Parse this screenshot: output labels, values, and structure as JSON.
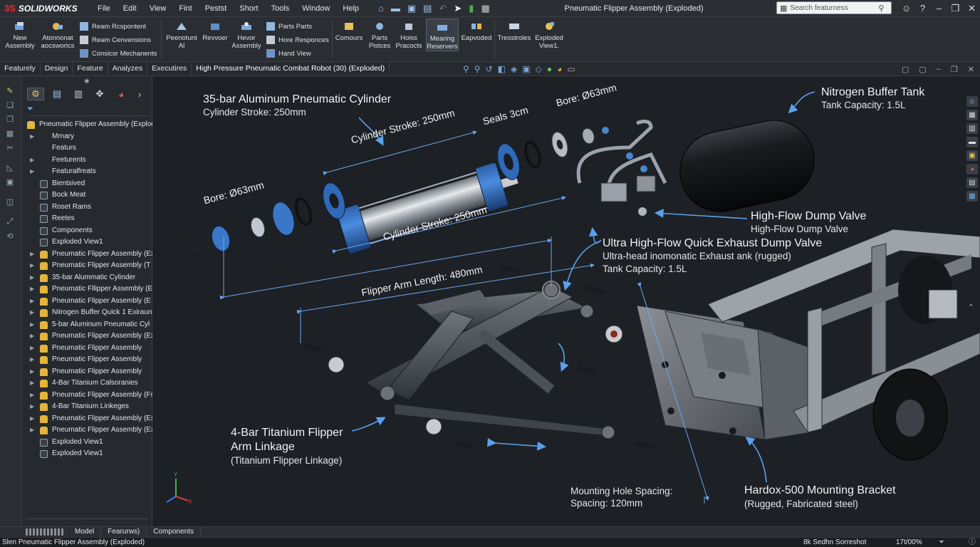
{
  "app": {
    "brand": "SOLIDWORKS",
    "brand_mark": "3S",
    "window_title": "Pneumatic Flipper Assembly (Exploded)"
  },
  "menu": [
    "File",
    "Edit",
    "View",
    "Fint",
    "Pestst",
    "Short",
    "Tools",
    "Window",
    "Help"
  ],
  "search": {
    "placeholder": "Search featurness"
  },
  "ribbon": {
    "new_assembly": "New\nAssembly",
    "atonnonat": "Atonnonat\naocsworics",
    "ream_respont": "Ream Rcspontent",
    "ream_convensions": "Ream Cenvensions",
    "consider_mechanents": "Consicsr Mechanents",
    "peenotunt": "Peenotunt\nAl",
    "revvoer": "Revvoer",
    "hevor_assembly": "Hevor\nAssembly",
    "parts_parts": "Parts Parts",
    "hore_responces": "Hore Responces",
    "hand_view": "Hand View",
    "comours": "Comours",
    "parts_pistces": "Parts\nPistces",
    "hoiss_pracocts": "Hoiss\nPracocts",
    "mearing_reservers": "Mearing\nReservers",
    "eapvoded": "Eapvoded",
    "tresstroles": "Tresstroles",
    "exploded_view": "Exploded\nView1."
  },
  "tabs": [
    "Featurely",
    "Design",
    "Feature",
    "Analyzes",
    "Executires"
  ],
  "document_tab": "High Pressure Pneumatic Combat Robot (30) (Exploded)",
  "tree": {
    "root": "Pneumatic Flipper Assembly (Explod",
    "items": [
      {
        "label": "Mrnary",
        "icon": "folder",
        "expand": true
      },
      {
        "label": "Featurs",
        "icon": "folder",
        "expand": false
      },
      {
        "label": "Feeturents",
        "icon": "folder",
        "expand": true
      },
      {
        "label": "Featuralfreats",
        "icon": "folder",
        "expand": true
      },
      {
        "label": "Bientsived",
        "icon": "doc",
        "expand": false
      },
      {
        "label": "Bock Meat",
        "icon": "doc",
        "expand": false
      },
      {
        "label": "Roset Rams",
        "icon": "doc",
        "expand": false
      },
      {
        "label": "Reetes",
        "icon": "doc",
        "expand": false
      },
      {
        "label": "Components",
        "icon": "doc",
        "expand": false
      },
      {
        "label": "Exploded View1",
        "icon": "doc",
        "expand": false
      },
      {
        "label": "Pneumatic Flipper Assembly (Ex",
        "icon": "asm",
        "expand": true
      },
      {
        "label": "Pneumatic Flipper Assembly (T",
        "icon": "asm",
        "expand": true
      },
      {
        "label": "35-bar Alummatic Cylinder",
        "icon": "asm",
        "expand": true
      },
      {
        "label": "Pneumatic Fllipper Assembly (E",
        "icon": "asm",
        "expand": true
      },
      {
        "label": "Pneumatic Flipper Assembly (E",
        "icon": "asm",
        "expand": true
      },
      {
        "label": "Nitrogen Buffer Quick 1 Exiraun",
        "icon": "asm",
        "expand": true
      },
      {
        "label": "5-bar Aluminum Pneumatic Cyl",
        "icon": "asm",
        "expand": true
      },
      {
        "label": "Pneumatic Flipper Assembly (Ex",
        "icon": "asm",
        "expand": true
      },
      {
        "label": "Pneumatic Flipper Assembly",
        "icon": "asm",
        "expand": true
      },
      {
        "label": "Pneumatic Flipper Assembly",
        "icon": "asm",
        "expand": true
      },
      {
        "label": "Pneumatic Flipper Assembly",
        "icon": "asm",
        "expand": true
      },
      {
        "label": "4-Bar Titanium Calsoranies",
        "icon": "asm",
        "expand": true
      },
      {
        "label": "Pneumatic Flipper Assembly (Fs",
        "icon": "asm",
        "expand": true
      },
      {
        "label": "4-Bar Titanium Linkeges",
        "icon": "asm",
        "expand": true
      },
      {
        "label": "Pneumatic Flipper Assembly (Ex",
        "icon": "asm",
        "expand": true
      },
      {
        "label": "Pneumatic Flipper Assembly (Ex",
        "icon": "asm",
        "expand": true
      },
      {
        "label": "Exploded View1",
        "icon": "doc",
        "expand": false
      },
      {
        "label": "Exploded View1",
        "icon": "doc",
        "expand": false
      }
    ]
  },
  "annotations": {
    "cyl_title": "35-bar Aluminum Pneumatic Cylinder",
    "cyl_stroke": "Cylinder Stroke: 250mm",
    "dim_stroke_top": "Cylinder Stroke: 250mm",
    "dim_stroke_bottom": "Cylinder Stroke: 250mm",
    "seals": "Seals 3cm",
    "bore_top": "Bore: Ø63mm",
    "bore_left": "Bore: Ø63mm",
    "tank_title": "Nitrogen Buffer Tank",
    "tank_capacity": "Tank Capacity: 1.5L",
    "dump_title": "High-Flow Dump Valve",
    "dump_sub": "High-Flow Dump Valve",
    "exhaust_title": "Ultra High-Flow Quick Exhaust Dump Valve",
    "exhaust_sub": "Ultra-head inomonatic Exhaust ank (rugged)",
    "exhaust_capacity": "Tank Capacity: 1.5L",
    "arm_length": "Flipper Arm Length: 480mm",
    "link_title_1": "4-Bar Titanium Flipper",
    "link_title_2": "Arm Linkage",
    "link_sub": "(Titanium Flipper Linkage)",
    "hole_title": "Mounting Hole Spacing:",
    "hole_sub": "Spacing: 120mm",
    "bracket_title": "Hardox-500 Mounting Bracket",
    "bracket_sub": "(Rugged, Fabricated steel)"
  },
  "bottom_tabs": [
    "Model",
    "Fearurws)",
    "Components"
  ],
  "status": {
    "left": "Slen Pneumatic Flipper Assembly (Exploded)",
    "middle": "8k Sedhn Sorreshot",
    "zoom": "17t/00%"
  }
}
